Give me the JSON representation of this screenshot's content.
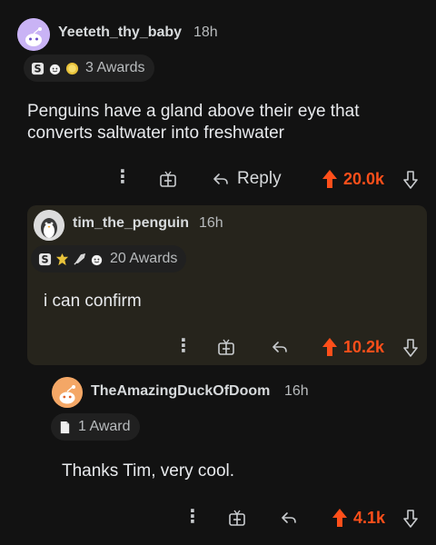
{
  "colors": {
    "background": "#121212",
    "upvote": "#ff4f1a",
    "text": "#d7dadc",
    "muted": "#b8bbbd",
    "highlight_bg": "#26241c"
  },
  "comments": [
    {
      "username": "Yeeteth_thy_baby",
      "age": "18h",
      "awards": "3 Awards",
      "award_icons": [
        "silver-award-icon",
        "wholesome-award-icon",
        "gold-award-icon"
      ],
      "body": [
        "Penguins have a gland above their eye that",
        "converts saltwater into freshwater"
      ],
      "reply_label": "Reply",
      "score": "20.0k",
      "avatar_icon": "snoo-avatar-icon"
    },
    {
      "username": "tim_the_penguin",
      "age": "16h",
      "awards": "20 Awards",
      "award_icons": [
        "silver-award-icon",
        "gold-crown-award-icon",
        "rocket-award-icon",
        "wholesome-award-icon"
      ],
      "body": [
        "i can confirm"
      ],
      "score": "10.2k",
      "avatar_icon": "penguin-avatar-icon"
    },
    {
      "username": "TheAmazingDuckOfDoom",
      "age": "16h",
      "awards": "1 Award",
      "award_icons": [
        "paper-award-icon"
      ],
      "body": [
        "Thanks Tim, very cool."
      ],
      "score": "4.1k",
      "avatar_icon": "snoo-avatar-icon"
    }
  ]
}
